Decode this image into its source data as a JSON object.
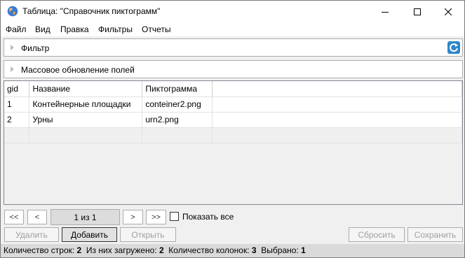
{
  "window": {
    "title": "Таблица: \"Справочник пиктограмм\"",
    "controls": {
      "minimize": "minimize",
      "maximize": "maximize",
      "close": "close"
    }
  },
  "menu": [
    "Файл",
    "Вид",
    "Правка",
    "Фильтры",
    "Отчеты"
  ],
  "filter_panel": {
    "label": "Фильтр"
  },
  "mass_update_panel": {
    "label": "Массовое обновление полей"
  },
  "table": {
    "columns": [
      "gid",
      "Название",
      "Пиктограмма"
    ],
    "rows": [
      [
        "1",
        "Контейнерные площадки",
        "conteiner2.png"
      ],
      [
        "2",
        "Урны",
        "urn2.png"
      ]
    ]
  },
  "pager": {
    "first": "<<",
    "prev": "<",
    "page_info": "1 из 1",
    "next": ">",
    "last": ">>",
    "show_all": "Показать все",
    "show_all_checked": false
  },
  "actions": {
    "delete": "Удалить",
    "add": "Добавить",
    "open": "Открыть",
    "reset": "Сбросить",
    "save": "Сохранить"
  },
  "status": {
    "rows_label": "Количество строк:",
    "rows_value": "2",
    "loaded_label": "Из них загружено:",
    "loaded_value": "2",
    "cols_label": "Количество колонок:",
    "cols_value": "3",
    "selected_label": "Выбрано:",
    "selected_value": "1"
  }
}
